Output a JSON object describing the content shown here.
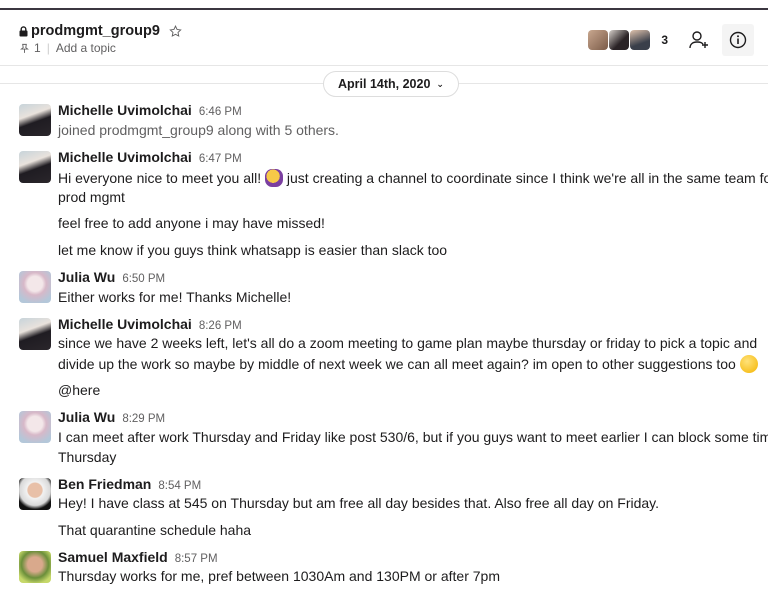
{
  "channel": {
    "name": "prodmgmt_group9",
    "pinned_count": "1",
    "topic_placeholder": "Add a topic",
    "member_count": "3",
    "icons": {
      "lock": "lock-icon",
      "star": "star-icon",
      "pin": "pin-icon",
      "add_member": "add-member-icon",
      "info": "info-icon"
    }
  },
  "date_divider": {
    "label": "April 14th, 2020",
    "icon": "chevron-down-icon"
  },
  "messages": [
    {
      "author": "Michelle Uvimolchai",
      "time": "6:46 PM",
      "lines": [
        "joined prodmgmt_group9 along with 5 others."
      ]
    },
    {
      "author": "Michelle Uvimolchai",
      "time": "6:47 PM",
      "lines": [
        "Hi everyone nice to meet you all!",
        "just creating a channel to coordinate since I think we're all in the same team for",
        "prod mgmt",
        "feel free to add anyone i may have missed!",
        "let me know if you guys think whatsapp is easier than slack too"
      ],
      "emoji": "person-raising-hand-emoji"
    },
    {
      "author": "Julia Wu",
      "time": "6:50 PM",
      "lines": [
        "Either works for me! Thanks Michelle!"
      ]
    },
    {
      "author": "Michelle Uvimolchai",
      "time": "8:26 PM",
      "lines": [
        "since we have 2 weeks left, let's all do a zoom meeting to game plan maybe thursday or friday to pick a topic and",
        "divide up the work so maybe by middle of next week we can all meet again? im open to other suggestions too",
        "@here"
      ],
      "emoji": "slightly-smiling-face-emoji"
    },
    {
      "author": "Julia Wu",
      "time": "8:29 PM",
      "lines": [
        "I can meet after work Thursday and Friday like post 530/6, but if you guys want to meet earlier I can block some time",
        "Thursday"
      ]
    },
    {
      "author": "Ben Friedman",
      "time": "8:54 PM",
      "lines": [
        "Hey! I have class at 545 on Thursday but am free all day besides that. Also free all day on Friday.",
        "That quarantine schedule haha"
      ]
    },
    {
      "author": "Samuel Maxfield",
      "time": "8:57 PM",
      "lines": [
        "Thursday works for me, pref between 1030Am and 130PM or after 7pm"
      ]
    }
  ]
}
